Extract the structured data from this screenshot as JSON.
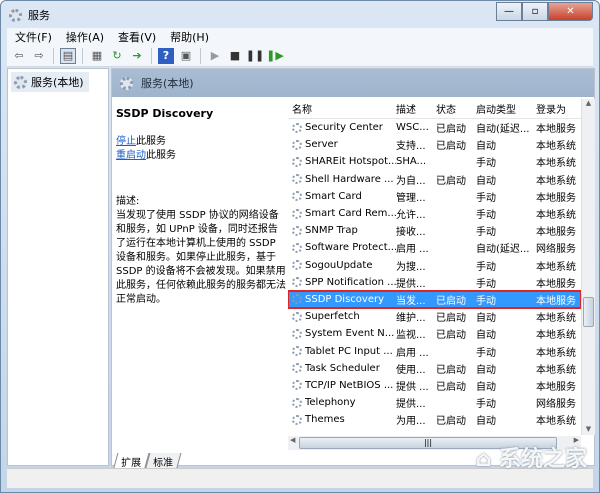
{
  "window": {
    "title": "服务",
    "controls": {
      "minimize": "—",
      "maximize": "▫",
      "close": "✕"
    }
  },
  "menu": [
    "文件(F)",
    "操作(A)",
    "查看(V)",
    "帮助(H)"
  ],
  "tree": {
    "root": "服务(本地)"
  },
  "panel": {
    "header": "服务(本地)"
  },
  "detail": {
    "name": "SSDP Discovery",
    "stop_link": "停止",
    "stop_suffix": "此服务",
    "restart_link": "重启动",
    "restart_suffix": "此服务",
    "desc_label": "描述:",
    "desc": "当发现了使用 SSDP 协议的网络设备和服务，如 UPnP 设备，同时还报告了运行在本地计算机上使用的 SSDP 设备和服务。如果停止此服务，基于 SSDP 的设备将不会被发现。如果禁用此服务，任何依赖此服务的服务都无法正常启动。"
  },
  "columns": [
    "名称",
    "描述",
    "状态",
    "启动类型",
    "登录为"
  ],
  "rows": [
    [
      "Security Center",
      "WSC...",
      "已启动",
      "自动(延迟...",
      "本地服务"
    ],
    [
      "Server",
      "支持...",
      "已启动",
      "自动",
      "本地系统"
    ],
    [
      "SHAREit Hotspot...",
      "SHA...",
      "",
      "手动",
      "本地系统"
    ],
    [
      "Shell Hardware ...",
      "为自...",
      "已启动",
      "自动",
      "本地系统"
    ],
    [
      "Smart Card",
      "管理...",
      "",
      "手动",
      "本地服务"
    ],
    [
      "Smart Card Rem...",
      "允许...",
      "",
      "手动",
      "本地系统"
    ],
    [
      "SNMP Trap",
      "接收...",
      "",
      "手动",
      "本地服务"
    ],
    [
      "Software Protect...",
      "启用 ...",
      "",
      "自动(延迟...",
      "网络服务"
    ],
    [
      "SogouUpdate",
      "为搜...",
      "",
      "手动",
      "本地系统"
    ],
    [
      "SPP Notification ...",
      "提供...",
      "",
      "手动",
      "本地服务"
    ],
    [
      "SSDP Discovery",
      "当发...",
      "已启动",
      "手动",
      "本地服务"
    ],
    [
      "Superfetch",
      "维护...",
      "已启动",
      "自动",
      "本地系统"
    ],
    [
      "System Event N...",
      "监视...",
      "已启动",
      "自动",
      "本地系统"
    ],
    [
      "Tablet PC Input ...",
      "启用 ...",
      "",
      "手动",
      "本地系统"
    ],
    [
      "Task Scheduler",
      "使用...",
      "已启动",
      "自动",
      "本地系统"
    ],
    [
      "TCP/IP NetBIOS ...",
      "提供 ...",
      "已启动",
      "自动",
      "本地服务"
    ],
    [
      "Telephony",
      "提供...",
      "",
      "手动",
      "网络服务"
    ],
    [
      "Themes",
      "为用...",
      "已启动",
      "自动",
      "本地系统"
    ]
  ],
  "selected_index": 10,
  "tabs": [
    "扩展",
    "标准"
  ],
  "watermark": "系统之家",
  "colors": {
    "selection": "#3399ff",
    "highlight_border": "#e02424",
    "link": "#1a5ec7"
  }
}
